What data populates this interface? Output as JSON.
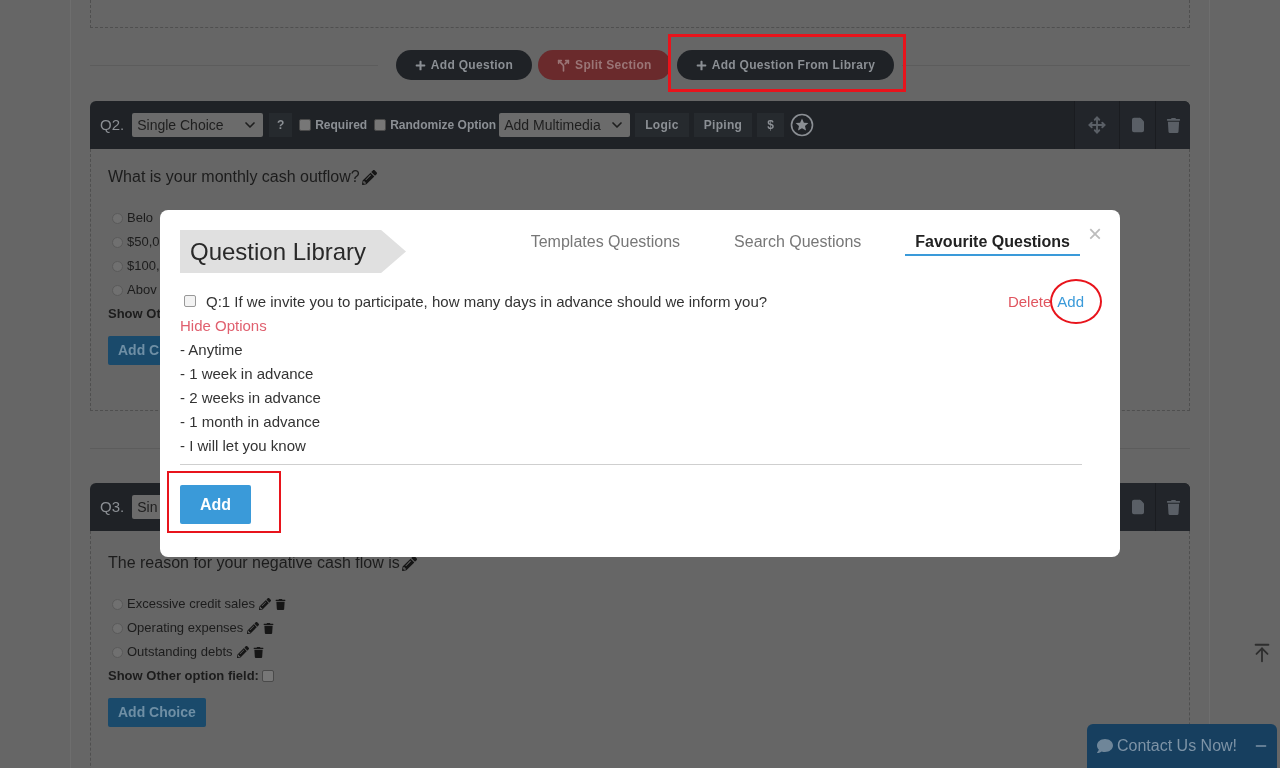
{
  "top_actions": [
    {
      "label": "Add Question",
      "kind": "dark"
    },
    {
      "label": "Split Section",
      "kind": "red"
    },
    {
      "label": "Add Question From Library",
      "kind": "dark"
    }
  ],
  "questions": [
    {
      "number": "Q2.",
      "type": "Single Choice",
      "help": "?",
      "required": {
        "label": "Required",
        "checked": false
      },
      "randomize": {
        "label": "Randomize Option",
        "checked": false
      },
      "multimedia": "Add Multimedia",
      "tools": [
        "Logic",
        "Piping",
        "$"
      ],
      "text": "What is your monthly cash outflow?",
      "options": [
        {
          "label": "Belo",
          "selected": false
        },
        {
          "label": "$50,0",
          "selected": false
        },
        {
          "label": "$100,",
          "selected": false
        },
        {
          "label": "Abov",
          "selected": false
        }
      ],
      "show_other": {
        "label": "Show Ot"
      },
      "add_choice": "Add C"
    },
    {
      "number": "Q3.",
      "type": "Sin",
      "text": "The reason for your negative cash flow is",
      "options": [
        {
          "label": "Excessive credit sales",
          "selected": false
        },
        {
          "label": "Operating expenses",
          "selected": false
        },
        {
          "label": "Outstanding debts",
          "selected": false
        }
      ],
      "options_editable": true,
      "show_other": {
        "label": "Show Other option field:",
        "checked": false
      },
      "add_choice": "Add Choice"
    }
  ],
  "modal": {
    "title": "Question Library",
    "close": "×",
    "tabs": [
      {
        "label": "Templates Questions",
        "selected": false
      },
      {
        "label": "Search Questions",
        "selected": false
      },
      {
        "label": "Favourite Questions",
        "selected": true
      }
    ],
    "items": [
      {
        "number": "Q:1",
        "text": "If we invite you to participate, how many days in advance should we inform you?",
        "checked": false,
        "delete": "Delete",
        "add": "Add",
        "toggle": "Hide Options",
        "expanded": true,
        "options": [
          "- Anytime",
          "- 1 week in advance",
          "- 2 weeks in advance",
          "- 1 month in advance",
          "- I will let you know"
        ]
      }
    ],
    "add_button": "Add"
  },
  "contact": {
    "label": "Contact Us Now!"
  }
}
